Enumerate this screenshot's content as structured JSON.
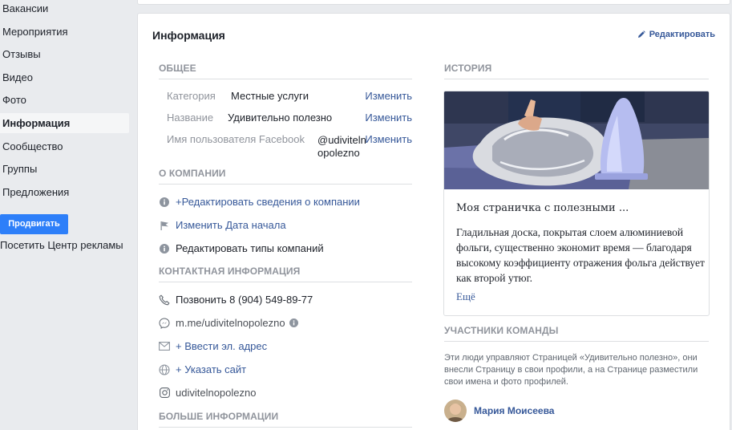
{
  "sidebar": {
    "items": [
      {
        "label": "Вакансии",
        "active": false
      },
      {
        "label": "Мероприятия",
        "active": false
      },
      {
        "label": "Отзывы",
        "active": false
      },
      {
        "label": "Видео",
        "active": false
      },
      {
        "label": "Фото",
        "active": false
      },
      {
        "label": "Информация",
        "active": true
      },
      {
        "label": "Сообщество",
        "active": false
      },
      {
        "label": "Группы",
        "active": false
      },
      {
        "label": "Предложения",
        "active": false
      }
    ],
    "promote_label": "Продвигать",
    "ads_center_label": "Посетить Центр рекламы"
  },
  "info": {
    "title": "Информация",
    "edit_label": "Редактировать"
  },
  "general": {
    "heading": "ОБЩЕЕ",
    "rows": [
      {
        "label": "Категория",
        "value": "Местные услуги",
        "action": "Изменить"
      },
      {
        "label": "Название",
        "value": "Удивительно полезно",
        "action": "Изменить"
      },
      {
        "label": "Имя пользователя Facebook",
        "value_line1": "@udiviteln",
        "value_line2": "opolezno",
        "action": "Изменить"
      }
    ]
  },
  "about": {
    "heading": "О КОМПАНИИ",
    "items": [
      {
        "icon": "info-icon",
        "text": "+Редактировать сведения о компании"
      },
      {
        "icon": "flag-icon",
        "text": "Изменить Дата начала"
      },
      {
        "icon": "info-icon",
        "text": "Редактировать типы компаний"
      }
    ]
  },
  "contact": {
    "heading": "КОНТАКТНАЯ ИНФОРМАЦИЯ",
    "phone": "Позвонить 8 (904) 549-89-77",
    "messenger": "m.me/udivitelnopolezno",
    "email": "+ Ввести эл. адрес",
    "website": "+ Указать сайт",
    "instagram": "udivitelnopolezno"
  },
  "more_info": {
    "heading": "БОЛЬШЕ ИНФОРМАЦИИ"
  },
  "story": {
    "heading": "ИСТОРИЯ",
    "title": "Моя страничка с полезными ...",
    "text": "Гладильная доска, покрытая слоем алюминиевой фольги, существенно экономит время — благодаря высокому коэффициенту отражения фольга действует как второй утюг.",
    "more": "Ещё"
  },
  "team": {
    "heading": "УЧАСТНИКИ КОМАНДЫ",
    "description": "Эти люди управляют Страницей «Удивительно полезно», они внесли Страницу в свои профили, а на Странице разместили свои имена и фото профилей.",
    "member_name": "Мария Моисеева"
  },
  "colors": {
    "accent": "#365899",
    "button": "#2d7ff9",
    "muted": "#90949c",
    "background": "#e9ebee"
  }
}
